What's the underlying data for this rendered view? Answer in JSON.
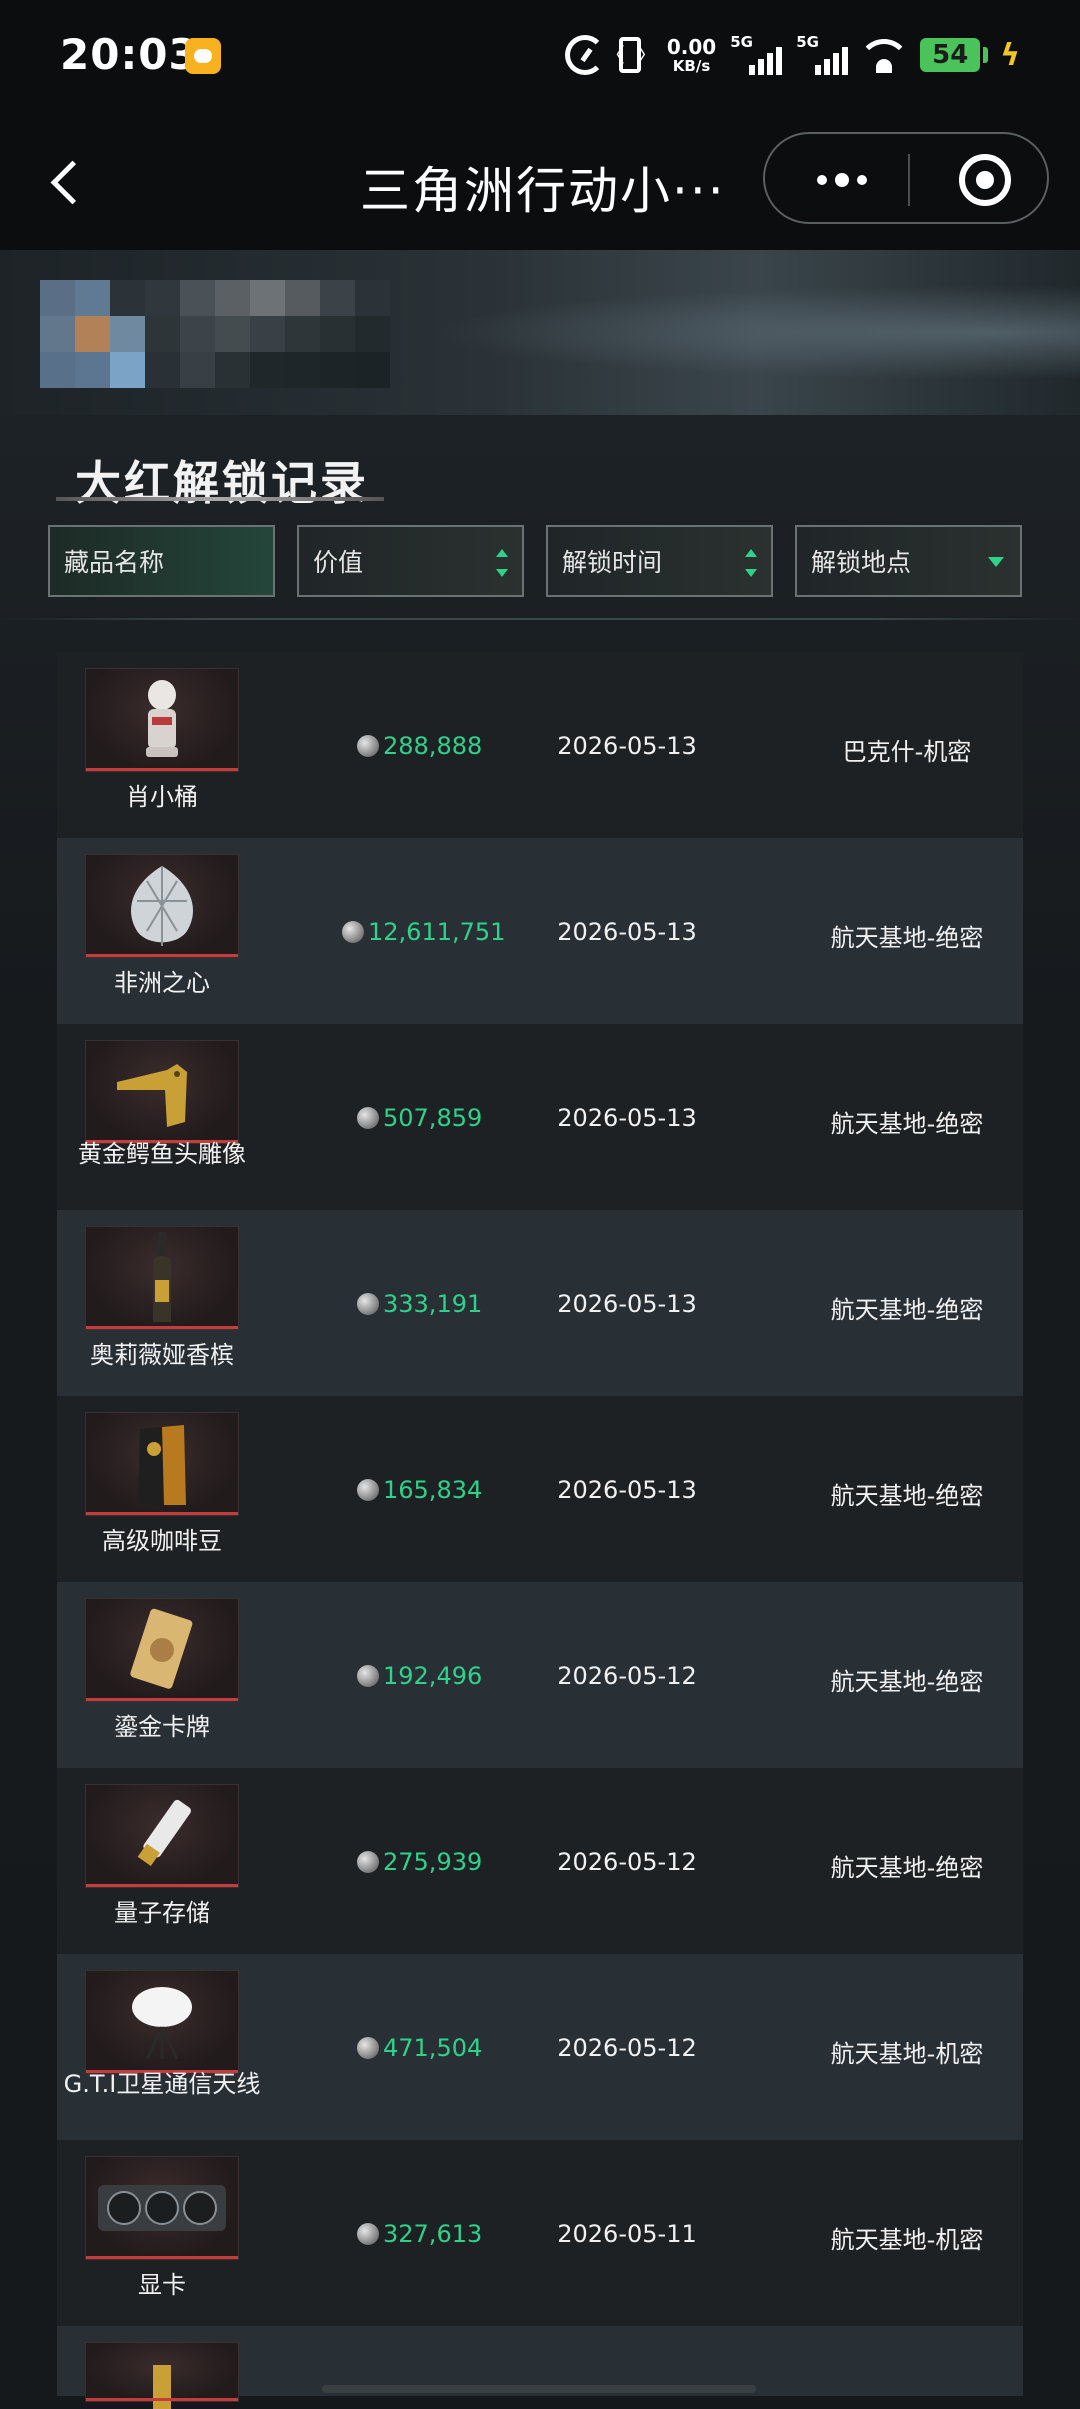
{
  "status_bar": {
    "time": "20:03",
    "net_speed_value": "0.00",
    "net_speed_unit": "KB/s",
    "sim1": "5G",
    "sim2": "5G",
    "battery": "54"
  },
  "title_bar": {
    "title": "三角洲行动小···"
  },
  "section": {
    "title": "大红解锁记录"
  },
  "filters": {
    "name": "藏品名称",
    "value": "价值",
    "time": "解锁时间",
    "location": "解锁地点"
  },
  "colors": {
    "accent_green": "#2fd28a",
    "row_dark": "#1d2124",
    "row_light": "#283036",
    "thumb_red_line": "#c63b3b"
  },
  "rows": [
    {
      "name": "肖小桶",
      "price": "288,888",
      "date": "2026-05-13",
      "location": "巴克什-机密",
      "icon": "figurine-icon"
    },
    {
      "name": "非洲之心",
      "price": "12,611,751",
      "date": "2026-05-13",
      "location": "航天基地-绝密",
      "icon": "diamond-icon"
    },
    {
      "name": "黄金鳄鱼头雕像",
      "price": "507,859",
      "date": "2026-05-13",
      "location": "航天基地-绝密",
      "icon": "gold-crocodile-icon"
    },
    {
      "name": "奥莉薇娅香槟",
      "price": "333,191",
      "date": "2026-05-13",
      "location": "航天基地-绝密",
      "icon": "champagne-icon"
    },
    {
      "name": "高级咖啡豆",
      "price": "165,834",
      "date": "2026-05-13",
      "location": "航天基地-绝密",
      "icon": "coffee-bag-icon"
    },
    {
      "name": "鎏金卡牌",
      "price": "192,496",
      "date": "2026-05-12",
      "location": "航天基地-绝密",
      "icon": "gold-card-icon"
    },
    {
      "name": "量子存储",
      "price": "275,939",
      "date": "2026-05-12",
      "location": "航天基地-绝密",
      "icon": "quantum-storage-icon"
    },
    {
      "name": "G.T.I卫星通信天线",
      "price": "471,504",
      "date": "2026-05-12",
      "location": "航天基地-机密",
      "icon": "satellite-antenna-icon"
    },
    {
      "name": "显卡",
      "price": "327,613",
      "date": "2026-05-11",
      "location": "航天基地-机密",
      "icon": "graphics-card-icon"
    }
  ]
}
